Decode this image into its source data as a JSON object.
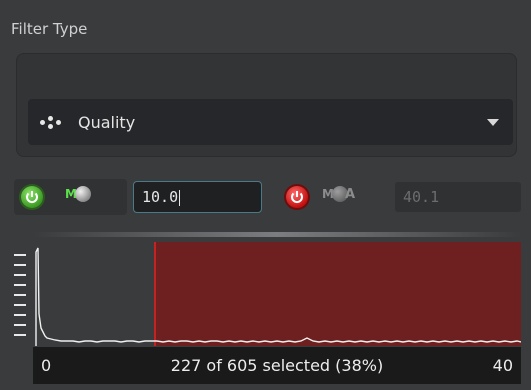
{
  "filter": {
    "title": "Filter Type",
    "selected": "Quality"
  },
  "controls": {
    "min_value": "10.0",
    "max_value": "40.1",
    "mode_label": "M"
  },
  "histogram": {
    "range_min": "0",
    "range_max": "40",
    "status": "227 of 605 selected (38%)",
    "selected_from": 10.0,
    "selected_to": 40.1,
    "selection_color": "#6e1f1f",
    "selection_edge_color": "#e82020"
  }
}
